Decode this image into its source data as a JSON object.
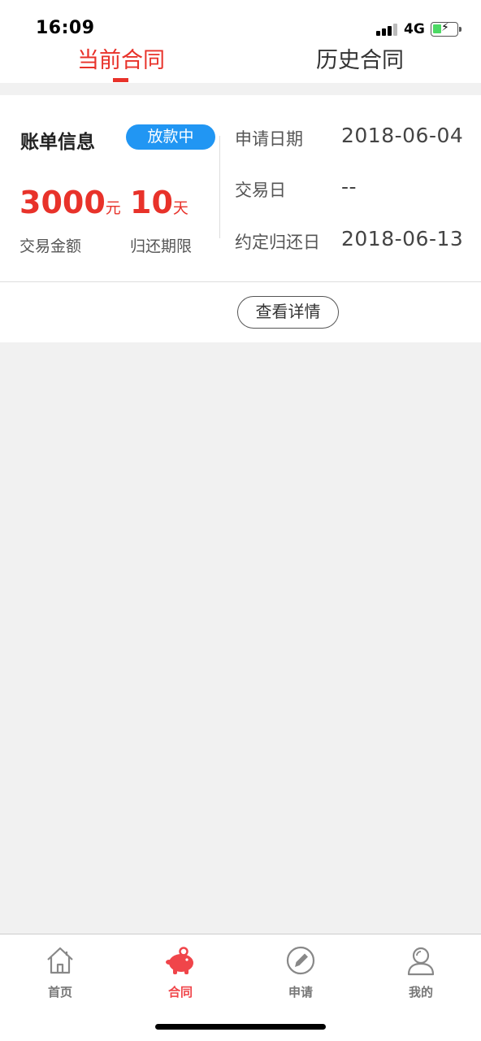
{
  "status_bar": {
    "time": "16:09",
    "network": "4G"
  },
  "tabs": [
    {
      "label": "当前合同",
      "active": true
    },
    {
      "label": "历史合同",
      "active": false
    }
  ],
  "bill": {
    "title": "账单信息",
    "status": "放款中",
    "amount": "3000",
    "amount_unit": "元",
    "amount_label": "交易金额",
    "term": "10",
    "term_unit": "天",
    "term_label": "归还期限",
    "info": [
      {
        "label": "申请日期",
        "value": "2018-06-04"
      },
      {
        "label": "交易日",
        "value": "--"
      },
      {
        "label": "约定归还日",
        "value": "2018-06-13"
      }
    ],
    "detail_button": "查看详情"
  },
  "tabbar": [
    {
      "label": "首页",
      "icon": "home-icon",
      "active": false
    },
    {
      "label": "合同",
      "icon": "piggy-bank-icon",
      "active": true
    },
    {
      "label": "申请",
      "icon": "edit-icon",
      "active": false
    },
    {
      "label": "我的",
      "icon": "user-icon",
      "active": false
    }
  ],
  "colors": {
    "accent": "#e8322a",
    "badge": "#2196f3",
    "tab_active": "#f0454a"
  }
}
